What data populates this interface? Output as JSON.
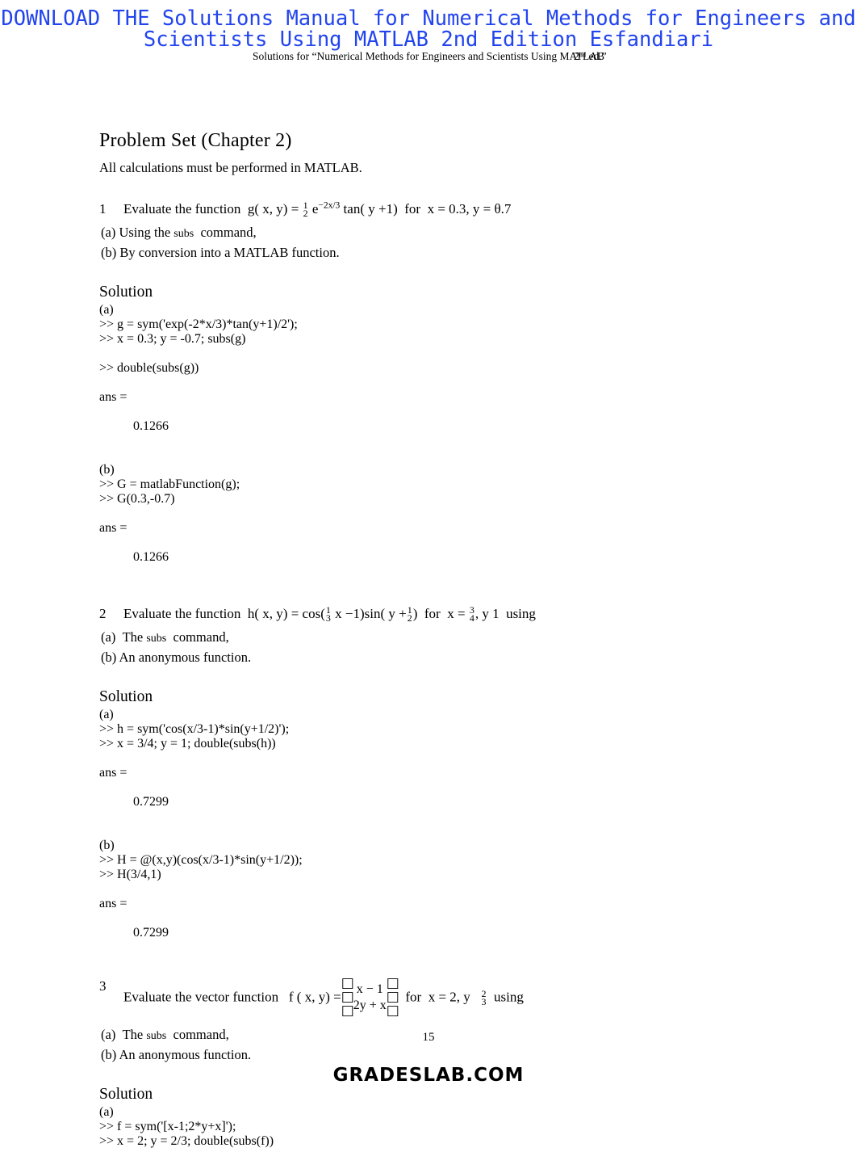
{
  "promo": {
    "text": "DOWNLOAD THE Solutions Manual for Numerical Methods for Engineers and Scientists Using MATLAB 2nd Edition Esfandiari",
    "color": "#2244ee"
  },
  "running_head": {
    "main": "Solutions for “Numerical Methods for Engineers and Scientists Using MATLAB",
    "overlap": "2ⁿᵈ ed.”"
  },
  "page": {
    "title": "Problem Set (Chapter 2)",
    "lead": "All calculations must be performed in MATLAB.",
    "number": "15",
    "site": "GRADESLAB.COM"
  },
  "problems": [
    {
      "number": "1",
      "statement_prefix": "Evaluate the function",
      "fn_name": "g( x, y) =",
      "coef_num": "1",
      "coef_den": "2",
      "base": "e",
      "exponent": "−2x/3",
      "tail": "tan( y +1)",
      "condition_pre": "for",
      "condition": "x = 0.3, y  =  θ.7",
      "condition_tail": "",
      "subitems": [
        {
          "label": "(a)",
          "pre": "Using  the",
          "mono": "subs",
          "post": "command,"
        },
        {
          "label": "(b)",
          "pre": "By conversion into a MATLAB function.",
          "mono": "",
          "post": ""
        }
      ],
      "solution_title": "Solution",
      "parts": [
        {
          "label": "(a)",
          "lines": [
            ">> g = sym('exp(-2*x/3)*tan(y+1)/2');",
            ">> x = 0.3; y = -0.7; subs(g)"
          ],
          "lines2": [
            ">> double(subs(g))"
          ],
          "ans_label": "ans =",
          "ans_value": "0.1266"
        },
        {
          "label": "(b)",
          "lines": [
            ">> G = matlabFunction(g);",
            ">> G(0.3,-0.7)"
          ],
          "lines2": [],
          "ans_label": "ans =",
          "ans_value": "0.1266"
        }
      ]
    },
    {
      "number": "2",
      "statement_prefix": "Evaluate the function",
      "fn_name": "h( x, y) = cos(",
      "c1_num": "1",
      "c1_den": "3",
      "mid": "x −1)sin( y +",
      "c2_num": "1",
      "c2_den": "2",
      "close": ")",
      "condition_pre": "for",
      "cond_x": "x =",
      "cx_num": "3",
      "cx_den": "4",
      "cond_y": ", y     1",
      "condition_tail": "using",
      "subitems": [
        {
          "label": "(a)",
          "pre": "The",
          "mono": "subs",
          "post": "command,"
        },
        {
          "label": "(b)",
          "pre": "An anonymous function.",
          "mono": "",
          "post": ""
        }
      ],
      "solution_title": "Solution",
      "parts": [
        {
          "label": "(a)",
          "lines": [
            ">> h = sym('cos(x/3-1)*sin(y+1/2)');",
            ">> x = 3/4; y = 1; double(subs(h))"
          ],
          "lines2": [],
          "ans_label": "ans =",
          "ans_value": "0.7299"
        },
        {
          "label": "(b)",
          "lines": [
            ">> H = @(x,y)(cos(x/3-1)*sin(y+1/2));",
            ">> H(3/4,1)"
          ],
          "lines2": [],
          "ans_label": "ans =",
          "ans_value": "0.7299"
        }
      ]
    },
    {
      "number": "3",
      "statement_prefix": "Evaluate the vector function",
      "fn_name": "f ( x,  y) =",
      "matrix_row1": "x − 1",
      "matrix_row2": "2y + x",
      "bracket_glyph": "□",
      "condition_pre": "for",
      "cond_x": "x = 2, y",
      "cy_num": "2",
      "cy_den": "3",
      "condition_tail": "using",
      "subitems": [
        {
          "label": "(a)",
          "pre": "The",
          "mono": "subs",
          "post": "command,"
        },
        {
          "label": "(b)",
          "pre": "An anonymous function.",
          "mono": "",
          "post": ""
        }
      ],
      "solution_title": "Solution",
      "parts": [
        {
          "label": "(a)",
          "lines": [
            ">> f = sym('[x-1;2*y+x]');",
            ">> x = 2; y = 2/3; double(subs(f))"
          ],
          "lines2": [],
          "ans_label": "",
          "ans_value": ""
        }
      ]
    }
  ]
}
